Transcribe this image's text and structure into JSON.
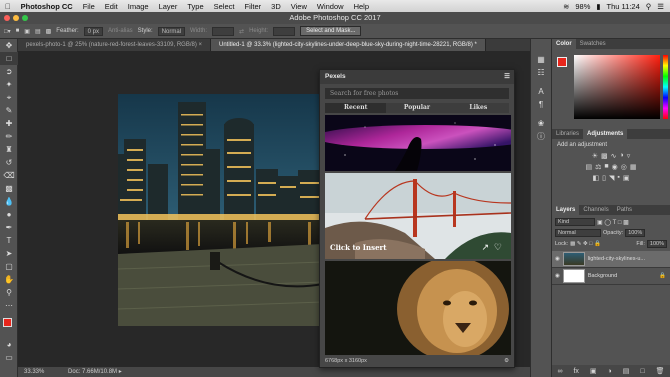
{
  "menubar": {
    "app": "Photoshop CC",
    "items": [
      "File",
      "Edit",
      "Image",
      "Layer",
      "Type",
      "Select",
      "Filter",
      "3D",
      "View",
      "Window",
      "Help"
    ],
    "battery": "98%",
    "time": "Thu 11:24"
  },
  "window": {
    "title": "Adobe Photoshop CC 2017"
  },
  "options": {
    "feather_label": "Feather:",
    "feather_value": "0 px",
    "antialias": "Anti-alias",
    "style_label": "Style:",
    "style_value": "Normal",
    "width_label": "Width:",
    "height_label": "Height:",
    "select_mask": "Select and Mask..."
  },
  "tabs": [
    "pexels-photo-1 @ 25% (nature-red-forest-leaves-33109, RGB/8) ×",
    "Untitled-1 @ 33.3% (lighted-city-skylines-under-deep-blue-sky-during-night-time-28221, RGB/8) *"
  ],
  "status": {
    "zoom": "33.33%",
    "doc": "Doc: 7.66M/10.8M"
  },
  "pexels": {
    "title": "Pexels",
    "search_placeholder": "Search for free photos",
    "tabs": [
      "Recent",
      "Popular",
      "Likes"
    ],
    "insert_label": "Click to Insert",
    "footer": "6768px x 3160px"
  },
  "panels": {
    "color_tab": "Color",
    "swatches_tab": "Swatches",
    "libraries_tab": "Libraries",
    "adjustments_tab": "Adjustments",
    "add_adjustment": "Add an adjustment",
    "layers_tab": "Layers",
    "channels_tab": "Channels",
    "paths_tab": "Paths",
    "kind": "Kind",
    "blend_mode": "Normal",
    "opacity_label": "Opacity:",
    "opacity_value": "100%",
    "lock_label": "Lock:",
    "fill_label": "Fill:",
    "fill_value": "100%",
    "layers": [
      "lighted-city-skylines-u...",
      "Background"
    ]
  },
  "colors": {
    "accent": "#e8261c"
  }
}
